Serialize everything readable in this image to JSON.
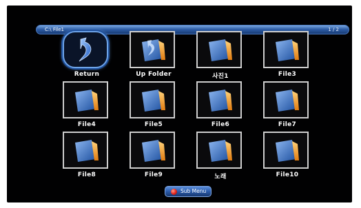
{
  "path_bar": {
    "path": "C:\\ File1",
    "page_indicator": "1 / 2"
  },
  "items": [
    {
      "label": "Return",
      "icon": "return-arrow-icon",
      "selected": true
    },
    {
      "label": "Up Folder",
      "icon": "up-folder-icon",
      "selected": false
    },
    {
      "label": "사진1",
      "icon": "folder-icon",
      "selected": false
    },
    {
      "label": "File3",
      "icon": "folder-icon",
      "selected": false
    },
    {
      "label": "File4",
      "icon": "folder-icon",
      "selected": false
    },
    {
      "label": "File5",
      "icon": "folder-icon",
      "selected": false
    },
    {
      "label": "File6",
      "icon": "folder-icon",
      "selected": false
    },
    {
      "label": "File7",
      "icon": "folder-icon",
      "selected": false
    },
    {
      "label": "File8",
      "icon": "folder-icon",
      "selected": false
    },
    {
      "label": "File9",
      "icon": "folder-icon",
      "selected": false
    },
    {
      "label": "노래",
      "icon": "folder-icon",
      "selected": false
    },
    {
      "label": "File10",
      "icon": "folder-icon",
      "selected": false
    }
  ],
  "sub_menu": {
    "label": "Sub Menu",
    "icon": "red-button-icon"
  },
  "colors": {
    "background": "#010102",
    "accent": "#2f5fa8",
    "folder": "#3a6fc0",
    "folder_tab": "#f39a1c",
    "tile_border": "#cfcfcf"
  }
}
